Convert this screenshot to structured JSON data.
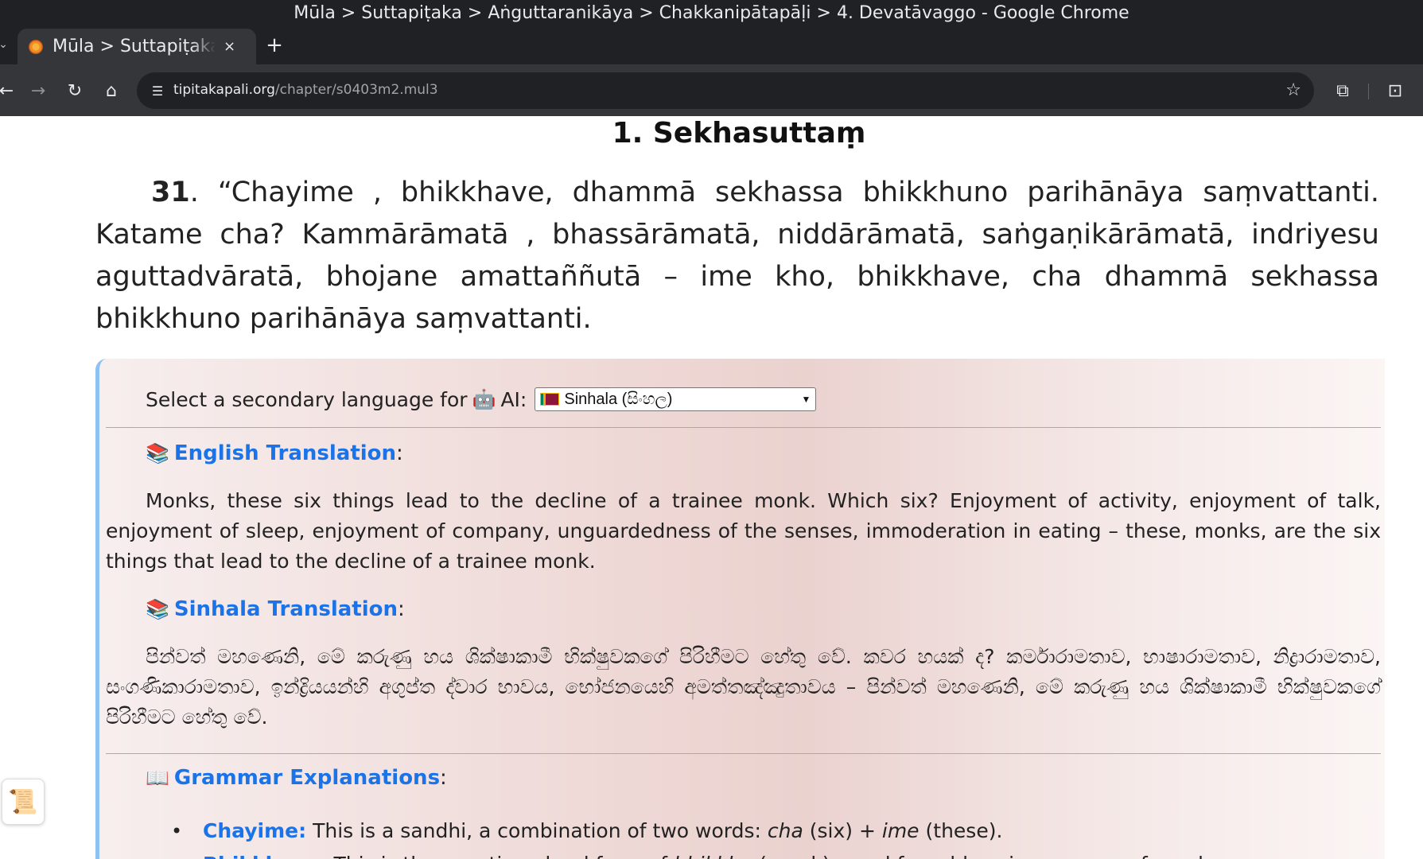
{
  "window": {
    "title": "Mūla > Suttapiṭaka > Aṅguttaranikāya > Chakkanipātapāḷi > 4. Devatāvaggo - Google Chrome"
  },
  "tab": {
    "title": "Mūla > Suttapiṭaka > Aṅguttaranikāya",
    "close_icon": "×",
    "new_tab_icon": "+"
  },
  "toolbar": {
    "url_host": "tipitakapali.org",
    "url_path": "/chapter/s0403m2.mul3"
  },
  "page": {
    "heading": "1. Sekhasuttaṃ",
    "pali_number": "31",
    "pali_text": ". “Chayime , bhikkhave, dhammā sekhassa bhikkhuno parihānāya saṃvattanti. Katame cha? Kammārāmatā , bhassārāmatā, niddārāmatā, saṅgaṇikārāmatā, indriyesu aguttadvāratā, bhojane amattaññutā – ime kho, bhikkhave, cha dhammā sekhassa bhikkhuno parihānāya saṃvattanti.",
    "ai": {
      "select_label": "Select a secondary language for",
      "robot_icon": "🤖",
      "select_suffix": "AI:",
      "select_value": "Sinhala (සිංහල)",
      "english_title": "English Translation",
      "english_text": "Monks, these six things lead to the decline of a trainee monk. Which six? Enjoyment of activity, enjoyment of talk, enjoyment of sleep, enjoyment of company, unguardedness of the senses, immoderation in eating – these, monks, are the six things that lead to the decline of a trainee monk.",
      "sinhala_title": "Sinhala Translation",
      "sinhala_text": "පින්වත් මහණෙනි, මේ කරුණු හය ශික්ෂාකාමී භික්ෂුවකගේ පිරිහීමට හේතු වේ. කවර හයක් ද? කර්මාරාමතාව, භාෂාරාමතාව, නිද්‍රාරාමතාව, සංගණිකාරාමතාව, ඉන්ද්‍රියයන්හි අගුප්ත ද්වාර භාවය, භෝජනයෙහි අමත්තඤ්ඤුතාවය – පින්වත් මහණෙනි, මේ කරුණු හය ශික්ෂාකාමී භික්ෂුවකගේ පිරිහීමට හේතු වේ.",
      "grammar_title": "Grammar Explanations",
      "colon": ":",
      "grammar_items": [
        {
          "term": "Chayime:",
          "pre": " This is a sandhi, a combination of two words: ",
          "w1": "cha",
          "mid": " (six) + ",
          "w2": "ime",
          "post": " (these)."
        },
        {
          "term": "Bhikkhave:",
          "pre": " This is the vocative plural form of ",
          "w1": "bhikkhu",
          "mid": " (monk), used for addressing a group of monks.",
          "w2": "",
          "post": ""
        }
      ]
    }
  }
}
